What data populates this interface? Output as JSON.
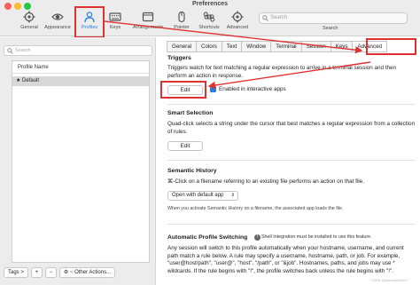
{
  "window": {
    "title": "Preferences"
  },
  "toolbar": {
    "items": [
      {
        "label": "General",
        "icon": "gear-icon"
      },
      {
        "label": "Appearance",
        "icon": "eye-icon"
      },
      {
        "label": "Profiles",
        "icon": "person-icon"
      },
      {
        "label": "Keys",
        "icon": "keyboard-icon"
      },
      {
        "label": "Arrangements",
        "icon": "window-icon"
      },
      {
        "label": "Pointer",
        "icon": "mouse-icon"
      },
      {
        "label": "Shortcuts",
        "icon": "command-icon"
      },
      {
        "label": "Advanced",
        "icon": "gear-icon"
      }
    ],
    "search_placeholder": "Search",
    "search_label": "Search"
  },
  "sidebar": {
    "search_placeholder": "Search",
    "column_header": "Profile Name",
    "profiles": [
      "★ Default"
    ],
    "tags_button": "Tags >",
    "add_button": "+",
    "remove_button": "−",
    "other_actions_button": "⚙ ~ Other Actions..."
  },
  "tabs": [
    "General",
    "Colors",
    "Text",
    "Window",
    "Terminal",
    "Session",
    "Keys",
    "Advanced"
  ],
  "triggers": {
    "title": "Triggers",
    "description": "Triggers watch for text matching a regular expression to arrive in a terminal session and then perform an action in response.",
    "edit_button": "Edit",
    "checkbox_label": "Enabled in interactive apps"
  },
  "smart_selection": {
    "title": "Smart Selection",
    "description": "Quad-click selects a string under the cursor that best matches a regular expression from a collection of rules.",
    "edit_button": "Edit"
  },
  "semantic_history": {
    "title": "Semantic History",
    "description": "⌘-Click on a filename referring to an existing file performs an action on that file.",
    "select_value": "Open with default app",
    "note": "When you activate Semantic History on a filename, the associated app loads the file."
  },
  "auto_switching": {
    "title": "Automatic Profile Switching",
    "shell_note": "Shell Integration must be installed to use this feature.",
    "description": "Any session will switch to this profile automatically when your hostname, username, and current path match a rule below. A rule may specify a username, hostname, path, or job. For example, \"user@host/path\", \"user@\", \"host\", \"/path\", or \"&job\". Hostnames, paths, and jobs may use * wildcards. If the rule begins with \"!\", the profile switches back unless the rule begins with \"!\"."
  },
  "watermark": "CSDN @sweetheart007",
  "colors": {
    "accent": "#2a7de1",
    "highlight": "#e03131"
  }
}
